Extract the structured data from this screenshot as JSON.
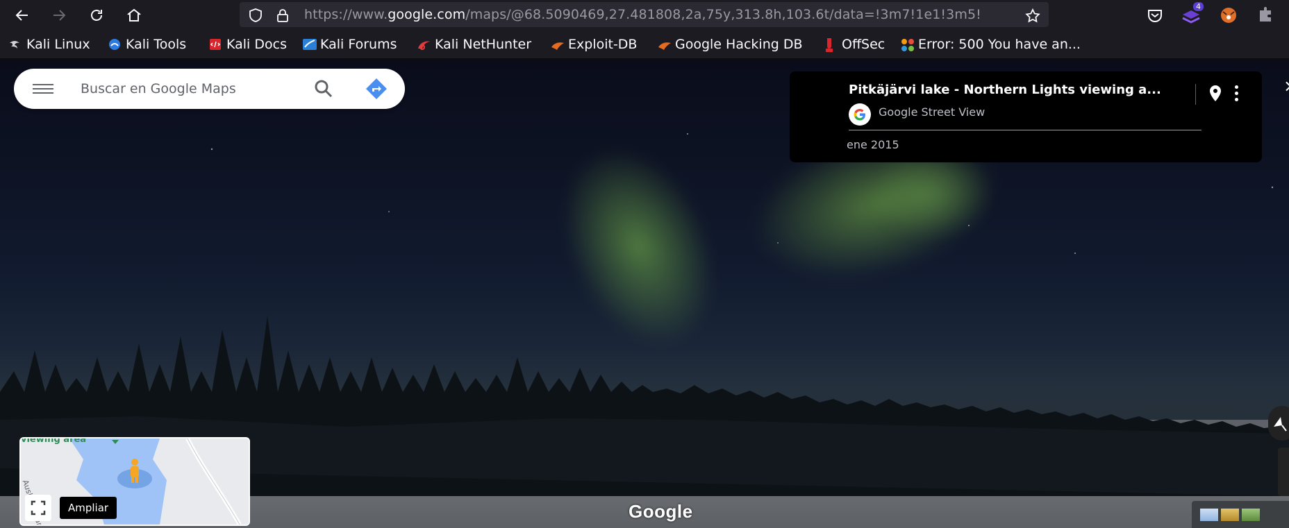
{
  "browser": {
    "url_prefix": "https://www.",
    "url_domain": "google.com",
    "url_rest": "/maps/@68.5090469,27.481808,2a,75y,313.8h,103.6t/data=!3m7!1e1!3m5!",
    "extension_badge": "4"
  },
  "bookmarks": [
    {
      "label": "Kali Linux",
      "icon": "kali-dragon-icon",
      "color": "#cfd2d6"
    },
    {
      "label": "Kali Tools",
      "icon": "kali-tools-icon",
      "color": "#2d7be0"
    },
    {
      "label": "Kali Docs",
      "icon": "kali-docs-icon",
      "color": "#d8262c"
    },
    {
      "label": "Kali Forums",
      "icon": "kali-forums-icon",
      "color": "#2a80d8"
    },
    {
      "label": "Kali NetHunter",
      "icon": "nethunter-icon",
      "color": "#e03c3c"
    },
    {
      "label": "Exploit-DB",
      "icon": "exploit-db-icon",
      "color": "#e46b1f"
    },
    {
      "label": "Google Hacking DB",
      "icon": "ghdb-icon",
      "color": "#e46b1f"
    },
    {
      "label": "OffSec",
      "icon": "offsec-icon",
      "color": "#d8262c"
    },
    {
      "label": "Error: 500 You have an...",
      "icon": "joomla-icon",
      "color": "#f39c12"
    }
  ],
  "search": {
    "placeholder": "Buscar en Google Maps"
  },
  "infocard": {
    "title": "Pitkäjärvi lake - Northern Lights viewing a...",
    "source": "Google Street View",
    "date": "ene 2015"
  },
  "minimap": {
    "road_label": "Auskottivaara",
    "area_label": "viewing area"
  },
  "tooltip": {
    "label": "Ampliar"
  },
  "branding": {
    "logo": "Google"
  }
}
